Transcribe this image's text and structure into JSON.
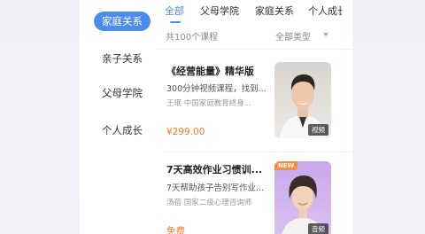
{
  "sidebar": {
    "items": [
      {
        "label": "家庭关系",
        "active": true
      },
      {
        "label": "亲子关系",
        "active": false
      },
      {
        "label": "父母学院",
        "active": false
      },
      {
        "label": "个人成长",
        "active": false
      }
    ]
  },
  "tabs": [
    {
      "label": "全部",
      "active": true
    },
    {
      "label": "父母学院",
      "active": false
    },
    {
      "label": "家庭关系",
      "active": false
    },
    {
      "label": "个人成长",
      "active": false
    }
  ],
  "list_header": {
    "count": "共100个课程",
    "filter": "全部类型"
  },
  "courses": [
    {
      "title": "《经营能量》精华版",
      "description": "300分钟视频课程，找到...",
      "author": "王珉   中国家庭教育终身...",
      "price": "¥299.00",
      "media_type": "视频",
      "is_new": false
    },
    {
      "title": "7天高效作业习惯训...",
      "description": "7天帮助孩子告别写作业...",
      "author": "汤蓓   国家二级心理咨询师",
      "price": "免费",
      "media_type": "音频",
      "is_new": true,
      "new_label": "NEW"
    }
  ],
  "colors": {
    "accent": "#4a8cf0",
    "price": "#f07a2a",
    "new_badge": "#ff8a3d"
  }
}
